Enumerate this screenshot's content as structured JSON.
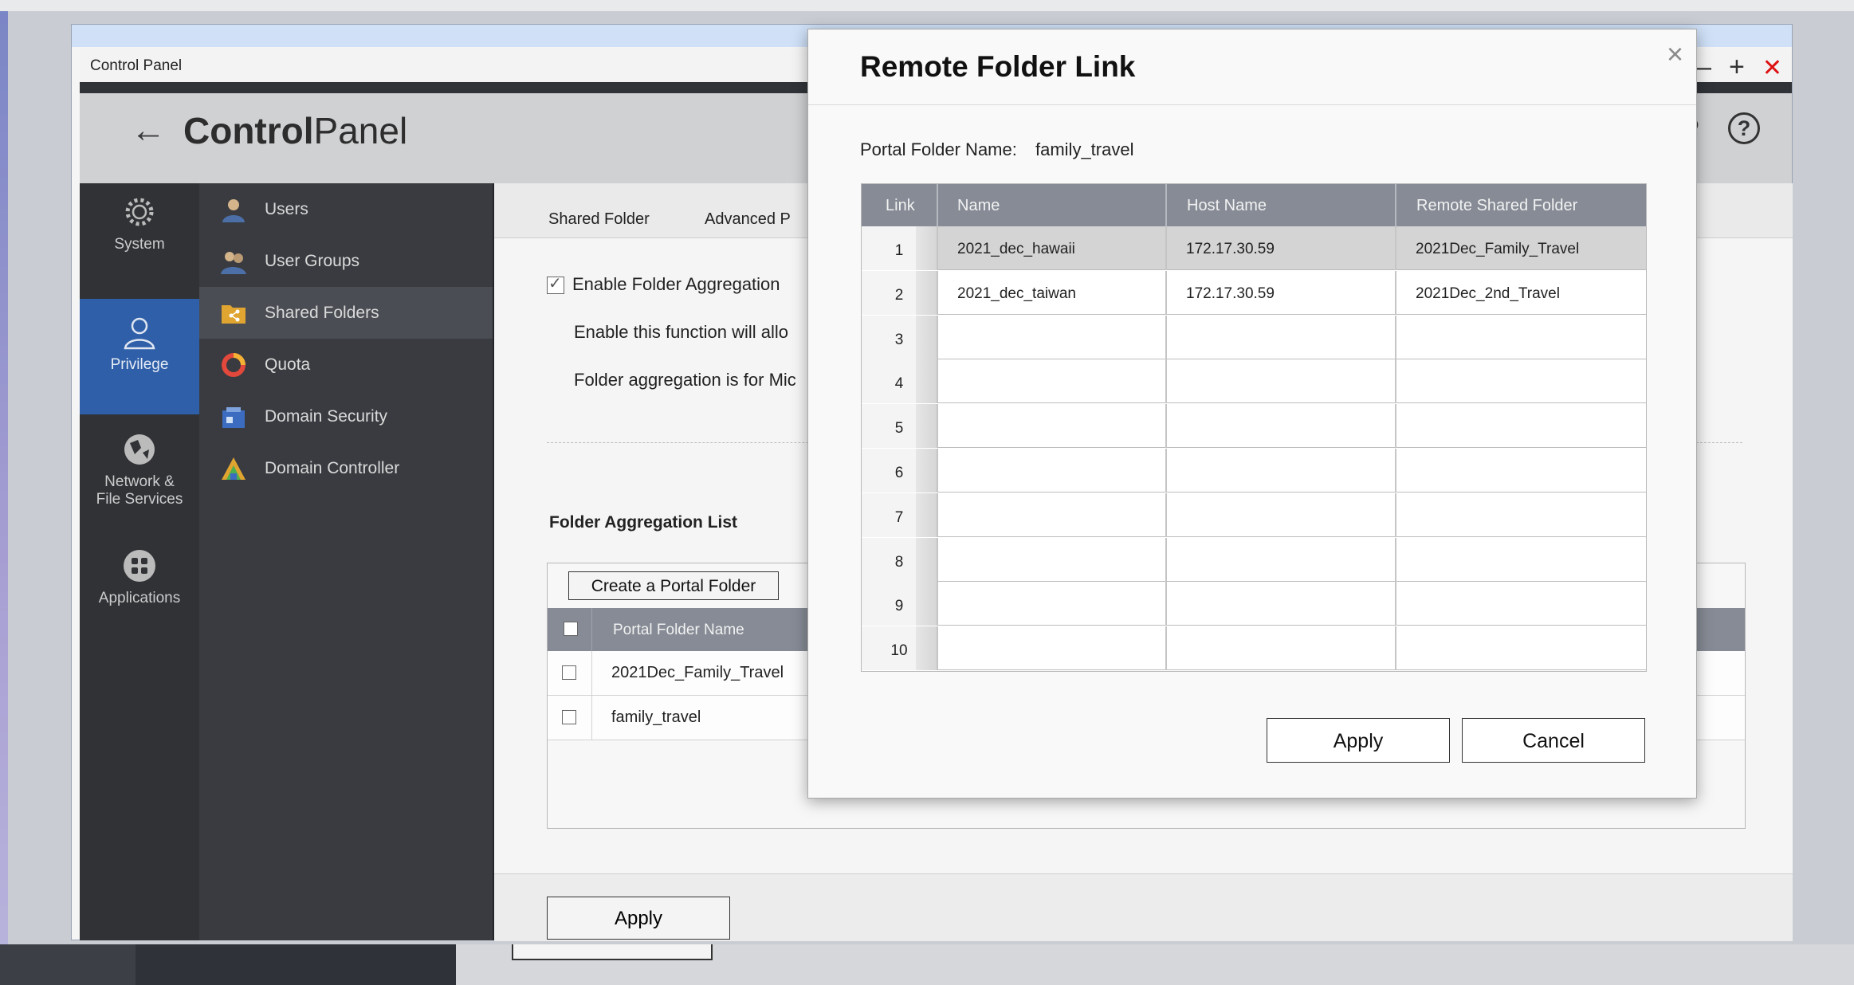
{
  "window": {
    "title": "Control Panel"
  },
  "header": {
    "logo_bold": "Control",
    "logo_light": "Panel",
    "help": "?"
  },
  "leftnav": [
    {
      "label": "System",
      "icon": "gear-icon"
    },
    {
      "label": "Privilege",
      "icon": "user-icon",
      "active": true
    },
    {
      "label": "Network &",
      "label2": "File Services",
      "icon": "globe-icon"
    },
    {
      "label": "Applications",
      "icon": "apps-icon"
    }
  ],
  "subnav": [
    {
      "label": "Users",
      "icon": "user-icon"
    },
    {
      "label": "User Groups",
      "icon": "user-group-icon"
    },
    {
      "label": "Shared Folders",
      "icon": "shared-folder-icon",
      "selected": true
    },
    {
      "label": "Quota",
      "icon": "quota-icon"
    },
    {
      "label": "Domain Security",
      "icon": "domain-security-icon"
    },
    {
      "label": "Domain Controller",
      "icon": "domain-controller-icon"
    }
  ],
  "tabs": {
    "shared_folder": "Shared Folder",
    "advanced": "Advanced P"
  },
  "content": {
    "enable_label": "Enable Folder Aggregation",
    "para1": "Enable this function will allo",
    "para2": "Folder aggregation is for Mic",
    "agg_title": "Folder Aggregation List",
    "create_button": "Create a Portal Folder",
    "col_portal": "Portal Folder Name",
    "rows": [
      "2021Dec_Family_Travel",
      "family_travel"
    ],
    "apply": "Apply"
  },
  "modal": {
    "title": "Remote Folder Link",
    "close": "×",
    "portal_label": "Portal Folder Name:",
    "portal_value": "family_travel",
    "headers": {
      "link": "Link",
      "name": "Name",
      "host": "Host Name",
      "remote": "Remote Shared Folder"
    },
    "rows": [
      {
        "link": "1",
        "name": "2021_dec_hawaii",
        "host": "172.17.30.59",
        "remote": "2021Dec_Family_Travel"
      },
      {
        "link": "2",
        "name": "2021_dec_taiwan",
        "host": "172.17.30.59",
        "remote": "2021Dec_2nd_Travel"
      },
      {
        "link": "3",
        "name": "",
        "host": "",
        "remote": ""
      },
      {
        "link": "4",
        "name": "",
        "host": "",
        "remote": ""
      },
      {
        "link": "5",
        "name": "",
        "host": "",
        "remote": ""
      },
      {
        "link": "6",
        "name": "",
        "host": "",
        "remote": ""
      },
      {
        "link": "7",
        "name": "",
        "host": "",
        "remote": ""
      },
      {
        "link": "8",
        "name": "",
        "host": "",
        "remote": ""
      },
      {
        "link": "9",
        "name": "",
        "host": "",
        "remote": ""
      },
      {
        "link": "10",
        "name": "",
        "host": "",
        "remote": ""
      }
    ],
    "apply": "Apply",
    "cancel": "Cancel"
  }
}
